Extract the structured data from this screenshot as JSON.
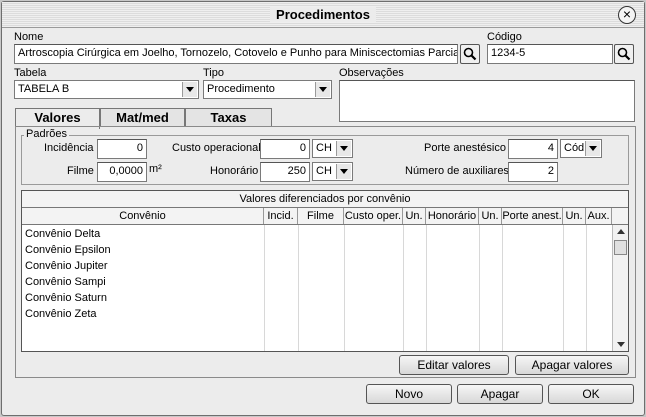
{
  "window": {
    "title": "Procedimentos"
  },
  "fields": {
    "nome": {
      "label": "Nome",
      "value": "Artroscopia Cirúrgica em Joelho, Tornozelo, Cotovelo e Punho para Miniscectomias Parciais"
    },
    "codigo": {
      "label": "Código",
      "value": "1234-5"
    },
    "tabela": {
      "label": "Tabela",
      "value": "TABELA B"
    },
    "tipo": {
      "label": "Tipo",
      "value": "Procedimento"
    },
    "observacoes": {
      "label": "Observações",
      "value": ""
    }
  },
  "tabs": [
    {
      "label": "Valores"
    },
    {
      "label": "Mat/med"
    },
    {
      "label": "Taxas"
    }
  ],
  "padroes": {
    "title": "Padrões",
    "incidencia": {
      "label": "Incidência",
      "value": "0"
    },
    "filme": {
      "label": "Filme",
      "value": "0,0000",
      "unit": "m²"
    },
    "custo_operacional": {
      "label": "Custo operacional",
      "value": "0",
      "unit": "CH"
    },
    "honorario": {
      "label": "Honorário",
      "value": "250",
      "unit": "CH"
    },
    "porte_anestesico": {
      "label": "Porte anestésico",
      "value": "4",
      "unit": "Cód"
    },
    "numero_auxiliares": {
      "label": "Número de auxiliares",
      "value": "2"
    }
  },
  "grid": {
    "title": "Valores diferenciados por convênio",
    "columns": [
      "Convênio",
      "Incid.",
      "Filme",
      "Custo oper.",
      "Un.",
      "Honorário",
      "Un.",
      "Porte anest.",
      "Un.",
      "Aux."
    ],
    "rows": [
      "Convênio Delta",
      "Convênio Epsilon",
      "Convênio Jupiter",
      "Convênio Sampi",
      "Convênio Saturn",
      "Convênio Zeta"
    ]
  },
  "buttons": {
    "editar": "Editar valores",
    "apagar_valores": "Apagar valores",
    "novo": "Novo",
    "apagar": "Apagar",
    "ok": "OK"
  },
  "icons": {
    "close": "close-icon",
    "search": "search-icon",
    "dropdown": "chevron-down-icon"
  }
}
